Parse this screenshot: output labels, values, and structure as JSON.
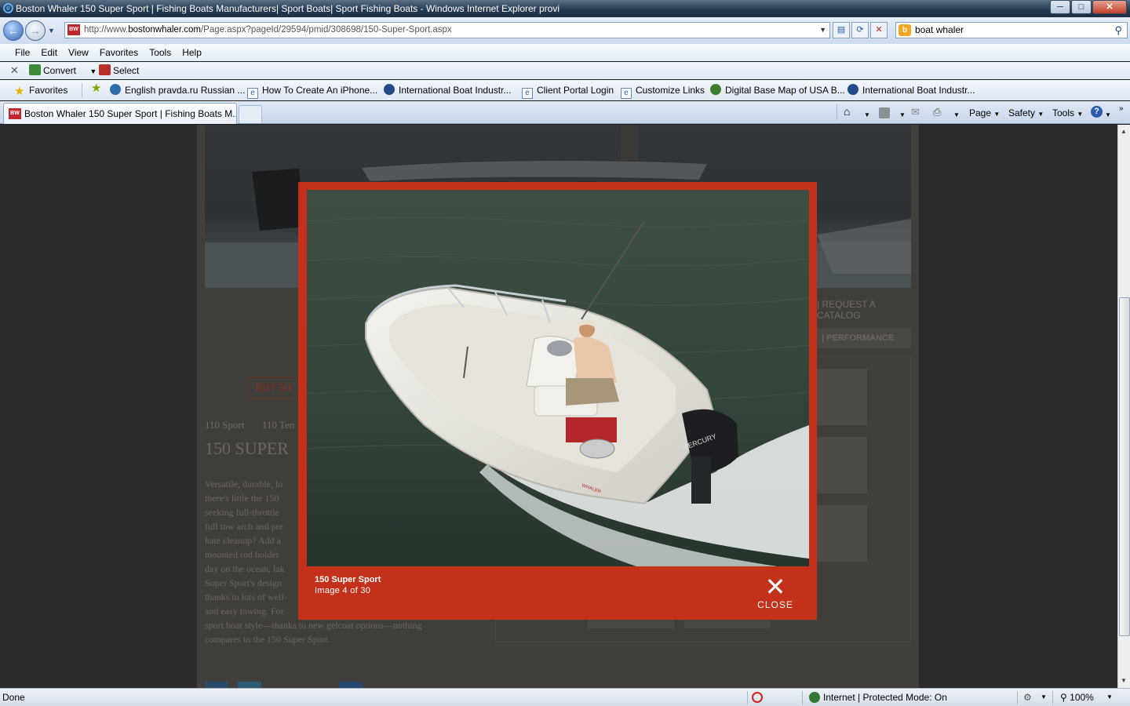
{
  "window": {
    "title": "Boston Whaler 150 Super Sport | Fishing Boats Manufacturers| Sport Boats| Sport Fishing Boats - Windows Internet Explorer provi",
    "min": "─",
    "max": "□",
    "close": "✕"
  },
  "address": {
    "url_prefix": "http://www.",
    "url_domain": "bostonwhaler.com",
    "url_path": "/Page.aspx?pageId/29594/pmid/308698/150-Super-Sport.aspx",
    "favicon": "BW"
  },
  "search": {
    "value": "boat whaler",
    "logo": "b"
  },
  "menu": [
    "File",
    "Edit",
    "View",
    "Favorites",
    "Tools",
    "Help"
  ],
  "toolbar": {
    "convert": "Convert",
    "select": "Select"
  },
  "favorites": {
    "label": "Favorites",
    "links": [
      "English pravda.ru Russian ...",
      "How To Create An iPhone...",
      "International Boat Industr...",
      "Client Portal Login",
      "Customize Links",
      "Digital Base Map of USA B...",
      "International Boat Industr..."
    ]
  },
  "tab": {
    "title": "Boston Whaler 150 Super Sport | Fishing Boats M..."
  },
  "commands": {
    "page": "Page",
    "safety": "Safety",
    "tools": "Tools"
  },
  "page": {
    "buy_button": "BUY SU",
    "breadcrumb": [
      "110 Sport",
      "110 Ten"
    ],
    "title": "150 SUPER",
    "paragraph_lines": [
      "Versatile, durable, lo",
      "there's little the 150",
      "seeking full-throttle",
      "full tow arch and pre",
      "hate cleanup? Add a",
      "mounted rod holder",
      "day on the ocean, lak",
      "Super Sport's design",
      "thanks to lots of well-",
      "and easy towing. For",
      "sport boat style—thanks to new gelcoat options—nothing",
      "compares to the 150 Super Sport."
    ],
    "request_catalog": "| REQUEST A CATALOG",
    "performance_tab": "| PERFORMANCE"
  },
  "lightbox": {
    "caption_title": "150 Super Sport",
    "caption_count": "Image 4 of 30",
    "close_label": "CLOSE",
    "close_glyph": "✕",
    "brand_color": "#c4311a"
  },
  "photo": {
    "motor_brand": "MERCURY",
    "hull_text": "WHALER"
  },
  "status": {
    "left": "Done",
    "zone": "Internet | Protected Mode: On",
    "zoom": "100%"
  }
}
